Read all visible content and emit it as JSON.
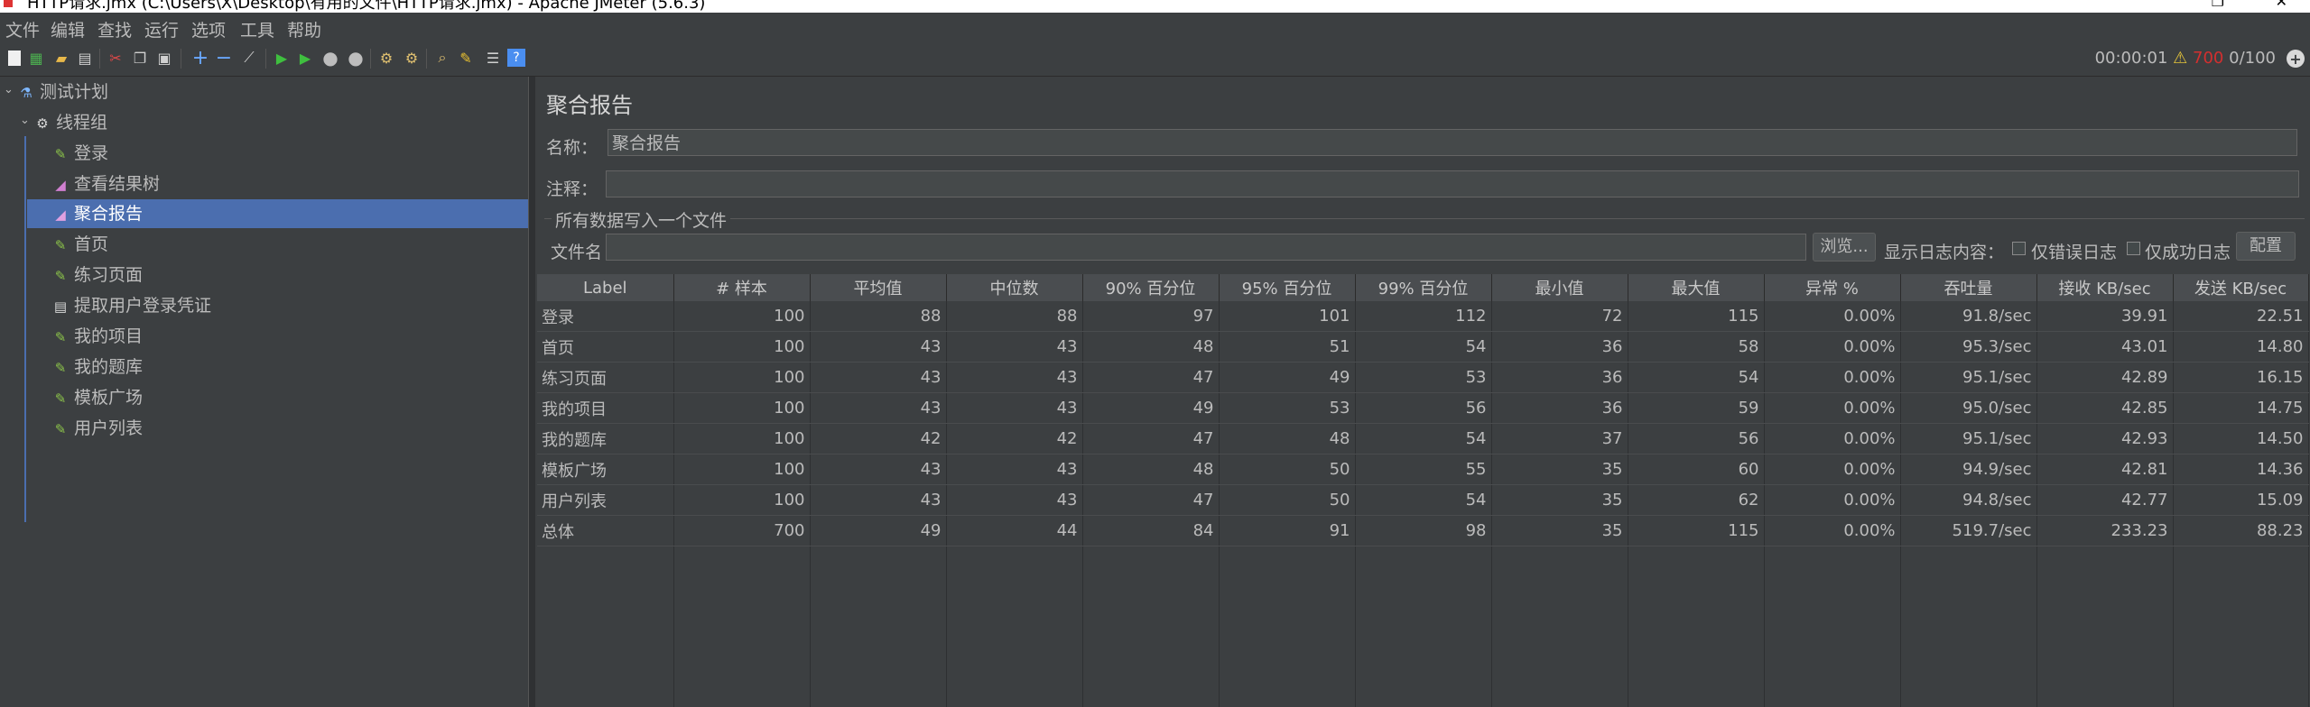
{
  "window": {
    "title": "HTTP请求.jmx (C:\\Users\\X\\Desktop\\有用的文件\\HTTP请求.jmx) - Apache JMeter (5.6.3)"
  },
  "menu": [
    "文件",
    "编辑",
    "查找",
    "运行",
    "选项",
    "工具",
    "帮助"
  ],
  "status": {
    "elapsed": "00:00:01",
    "errors": "700",
    "threads": "0/100"
  },
  "tree": {
    "test_plan": "测试计划",
    "thread_group": "线程组",
    "children": [
      "登录",
      "查看结果树",
      "聚合报告",
      "首页",
      "练习页面",
      "提取用户登录凭证",
      "我的项目",
      "我的题库",
      "模板广场",
      "用户列表"
    ]
  },
  "panel": {
    "title": "聚合报告",
    "name_label": "名称：",
    "name_value": "聚合报告",
    "comment_label": "注释：",
    "comment_value": "",
    "file_section": "所有数据写入一个文件",
    "filename_label": "文件名",
    "browse": "浏览...",
    "log_label": "显示日志内容：",
    "errors_only": "仅错误日志",
    "success_only": "仅成功日志",
    "configure": "配置"
  },
  "table": {
    "headers": [
      "Label",
      "# 样本",
      "平均值",
      "中位数",
      "90% 百分位",
      "95% 百分位",
      "99% 百分位",
      "最小值",
      "最大值",
      "异常 %",
      "吞吐量",
      "接收 KB/sec",
      "发送 KB/sec"
    ],
    "rows": [
      [
        "登录",
        "100",
        "88",
        "88",
        "97",
        "101",
        "112",
        "72",
        "115",
        "0.00%",
        "91.8/sec",
        "39.91",
        "22.51"
      ],
      [
        "首页",
        "100",
        "43",
        "43",
        "48",
        "51",
        "54",
        "36",
        "58",
        "0.00%",
        "95.3/sec",
        "43.01",
        "14.80"
      ],
      [
        "练习页面",
        "100",
        "43",
        "43",
        "47",
        "49",
        "53",
        "36",
        "54",
        "0.00%",
        "95.1/sec",
        "42.89",
        "16.15"
      ],
      [
        "我的项目",
        "100",
        "43",
        "43",
        "49",
        "53",
        "56",
        "36",
        "59",
        "0.00%",
        "95.0/sec",
        "42.85",
        "14.75"
      ],
      [
        "我的题库",
        "100",
        "42",
        "42",
        "47",
        "48",
        "54",
        "37",
        "56",
        "0.00%",
        "95.1/sec",
        "42.93",
        "14.50"
      ],
      [
        "模板广场",
        "100",
        "43",
        "43",
        "48",
        "50",
        "55",
        "35",
        "60",
        "0.00%",
        "94.9/sec",
        "42.81",
        "14.36"
      ],
      [
        "用户列表",
        "100",
        "43",
        "43",
        "47",
        "50",
        "54",
        "35",
        "62",
        "0.00%",
        "94.8/sec",
        "42.77",
        "15.09"
      ],
      [
        "总体",
        "700",
        "49",
        "44",
        "84",
        "91",
        "98",
        "35",
        "115",
        "0.00%",
        "519.7/sec",
        "233.23",
        "88.23"
      ]
    ]
  },
  "colors": {
    "background": "#3c3f41",
    "selection": "#4b6eaf",
    "error": "#d32f2f",
    "warning": "#e6c53a"
  }
}
